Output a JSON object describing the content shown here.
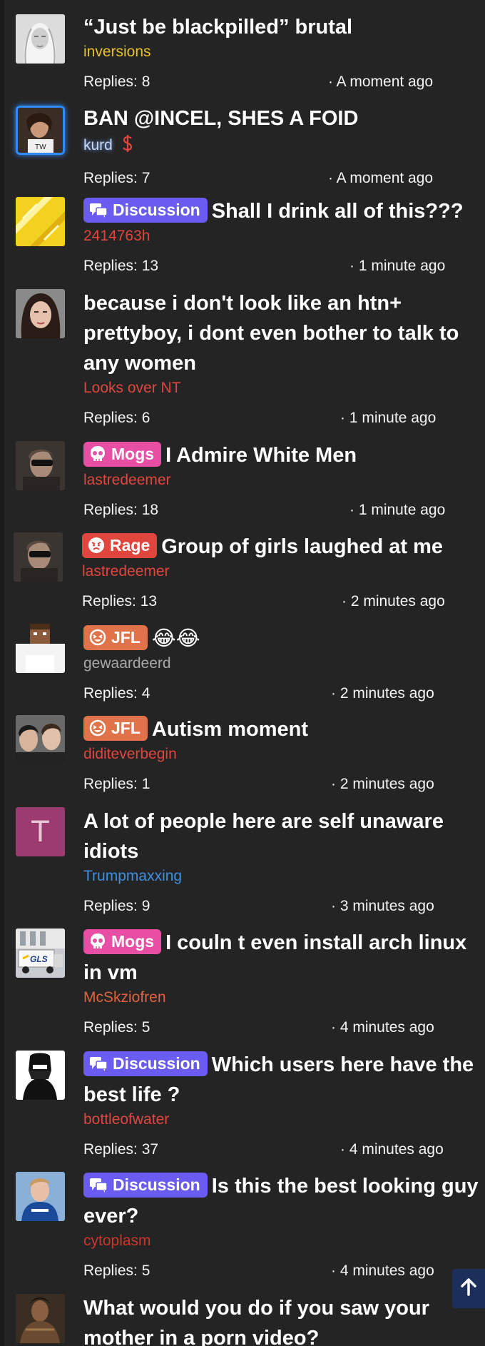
{
  "threads": [
    {
      "title": "“Just be blackpilled” brutal",
      "tag": "",
      "author": "inversions",
      "author_color": "#e8c12a",
      "replies": "Replies: 8",
      "time": "· A moment ago",
      "avatar": "woman-photo"
    },
    {
      "title": "BAN @INCEL, SHES A FOID",
      "tag": "",
      "author": "kurd",
      "author_color": "#c9d8f0",
      "author_icon": "dollar-icon",
      "replies": "Replies: 7",
      "time": "· A moment ago",
      "avatar": "girl-photo"
    },
    {
      "title": "Shall I drink all of this???",
      "tag": "Discussion",
      "author": "2414763h",
      "author_color": "#e0463d",
      "replies": "Replies: 13",
      "time": "· 1 minute ago",
      "avatar": "yellow-abstract"
    },
    {
      "title": "because i don't look like an htn+ prettyboy, i dont even bother to talk to any women",
      "tag": "",
      "author": "Looks over NT",
      "author_color": "#e0463d",
      "replies": "Replies: 6",
      "time": "· 1 minute ago",
      "avatar": "woman-dark-hair"
    },
    {
      "title": "I Admire White Men",
      "tag": "Mogs",
      "author": "lastredeemer",
      "author_color": "#e0463d",
      "replies": "Replies: 18",
      "time": "· 1 minute ago",
      "avatar": "man-sunglasses"
    },
    {
      "title": "Group of girls laughed at me",
      "tag": "Rage",
      "author": "lastredeemer",
      "author_color": "#e0463d",
      "replies": "Replies: 13",
      "time": "· 2 minutes ago",
      "avatar": "man-sunglasses"
    },
    {
      "title": "😂😂",
      "tag": "JFL",
      "author": "gewaardeerd",
      "author_color": "#a8a8a8",
      "replies": "Replies: 4",
      "time": "· 2 minutes ago",
      "avatar": "pixel-character"
    },
    {
      "title": "Autism moment",
      "tag": "JFL",
      "author": "diditeverbegin",
      "author_color": "#e0463d",
      "replies": "Replies: 1",
      "time": "· 2 minutes ago",
      "avatar": "two-men"
    },
    {
      "title": "A lot of people here are self unaware idiots",
      "tag": "",
      "author": "Trumpmaxxing",
      "author_color": "#3d8fe0",
      "replies": "Replies: 9",
      "time": "· 3 minutes ago",
      "avatar": "letter-avatar",
      "avatar_letter": "T"
    },
    {
      "title": "I couln t even install arch linux in vm",
      "tag": "Mogs",
      "author": "McSkziofren",
      "author_color": "#e0633d",
      "replies": "Replies: 5",
      "time": "· 4 minutes ago",
      "avatar": "gls-truck",
      "avatar_text": "GLS"
    },
    {
      "title": "Which users here have the best life ?",
      "tag": "Discussion",
      "author": "bottleofwater",
      "author_color": "#e0463d",
      "replies": "Replies: 37",
      "time": "· 4 minutes ago",
      "avatar": "masked-figure"
    },
    {
      "title": "Is this the best looking guy ever?",
      "tag": "Discussion",
      "author": "cytoplasm",
      "author_color": "#d0342c",
      "replies": "Replies: 5",
      "time": "· 4 minutes ago",
      "avatar": "basketball-player"
    },
    {
      "title": "What would you do if you saw your mother in a porn video?",
      "tag": "",
      "author": "",
      "replies": "",
      "time": "",
      "avatar": "warrior-photo"
    }
  ],
  "scroll_top": {
    "icon": "arrow-up-icon"
  },
  "colors": {
    "background": "#242424",
    "discussion": "#6a5cf0",
    "mogs": "#e84fa4",
    "rage": "#e0463d",
    "jfl": "#e0734a"
  }
}
